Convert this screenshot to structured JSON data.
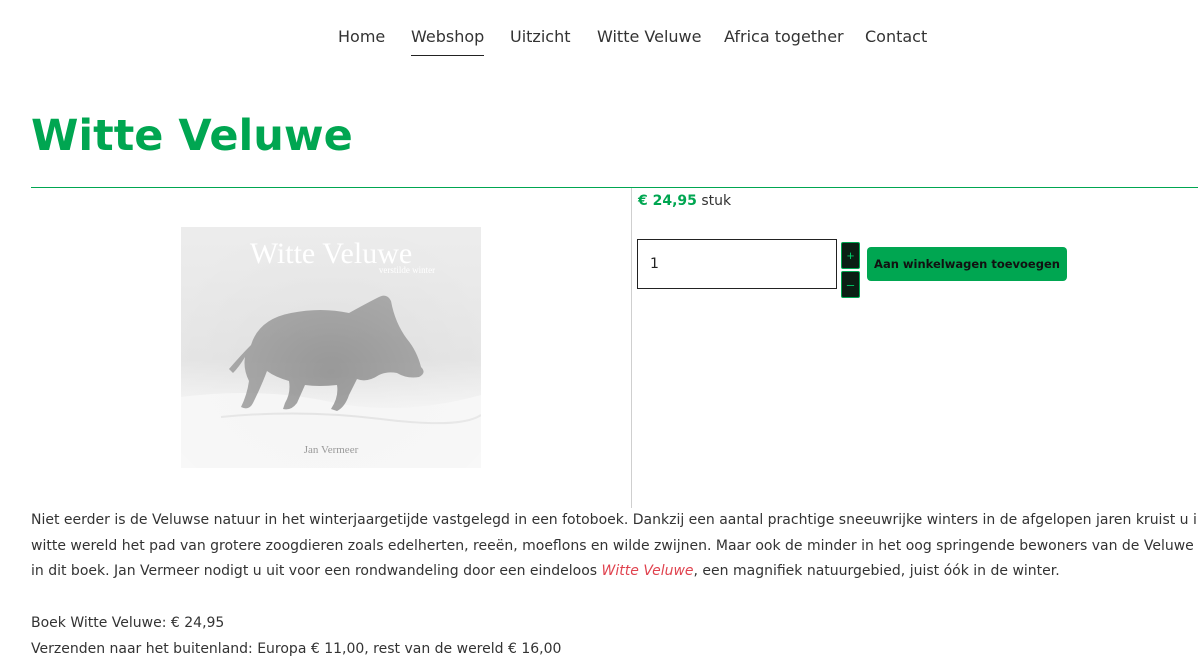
{
  "nav": {
    "items": [
      {
        "label": "Home"
      },
      {
        "label": "Webshop"
      },
      {
        "label": "Uitzicht"
      },
      {
        "label": "Witte Veluwe"
      },
      {
        "label": "Africa together"
      },
      {
        "label": "Contact"
      }
    ],
    "active": "Webshop"
  },
  "product": {
    "title": "Witte Veluwe",
    "image": {
      "cover_title": "Witte Veluwe",
      "cover_subtitle": "verstilde winter",
      "cover_author": "Jan Vermeer"
    },
    "price": "€ 24,95",
    "unit": "stuk",
    "quantity": "1",
    "stepper_plus": "+",
    "stepper_minus": "–",
    "add_to_cart": "Aan winkelwagen toevoegen"
  },
  "description": {
    "line1": "Niet eerder is de Veluwse natuur in het winterjaargetijde vastgelegd in een fotoboek. Dankzij een aantal prachtige sneeuwrijke winters in de afgelopen jaren kruist u in een",
    "line2": "witte wereld het pad van grotere zoogdieren zoals edelherten, reeën, moeflons en wilde zwijnen. Maar ook de minder in het oog springende bewoners van de Veluwe ontmo",
    "line3_before": "in dit boek. Jan Vermeer nodigt u uit voor een rondwandeling door een eindeloos ",
    "line3_link": "Witte Veluwe",
    "line3_after": ", een magnifiek natuurgebied, juist óók in de winter."
  },
  "info": {
    "book_price": "Boek Witte Veluwe:  € 24,95",
    "shipping": "Verzenden naar het buitenland: Europa € 11,00, rest van de wereld € 16,00"
  },
  "colors": {
    "accent": "#00a651",
    "link": "#e0434f",
    "text": "#333333"
  }
}
